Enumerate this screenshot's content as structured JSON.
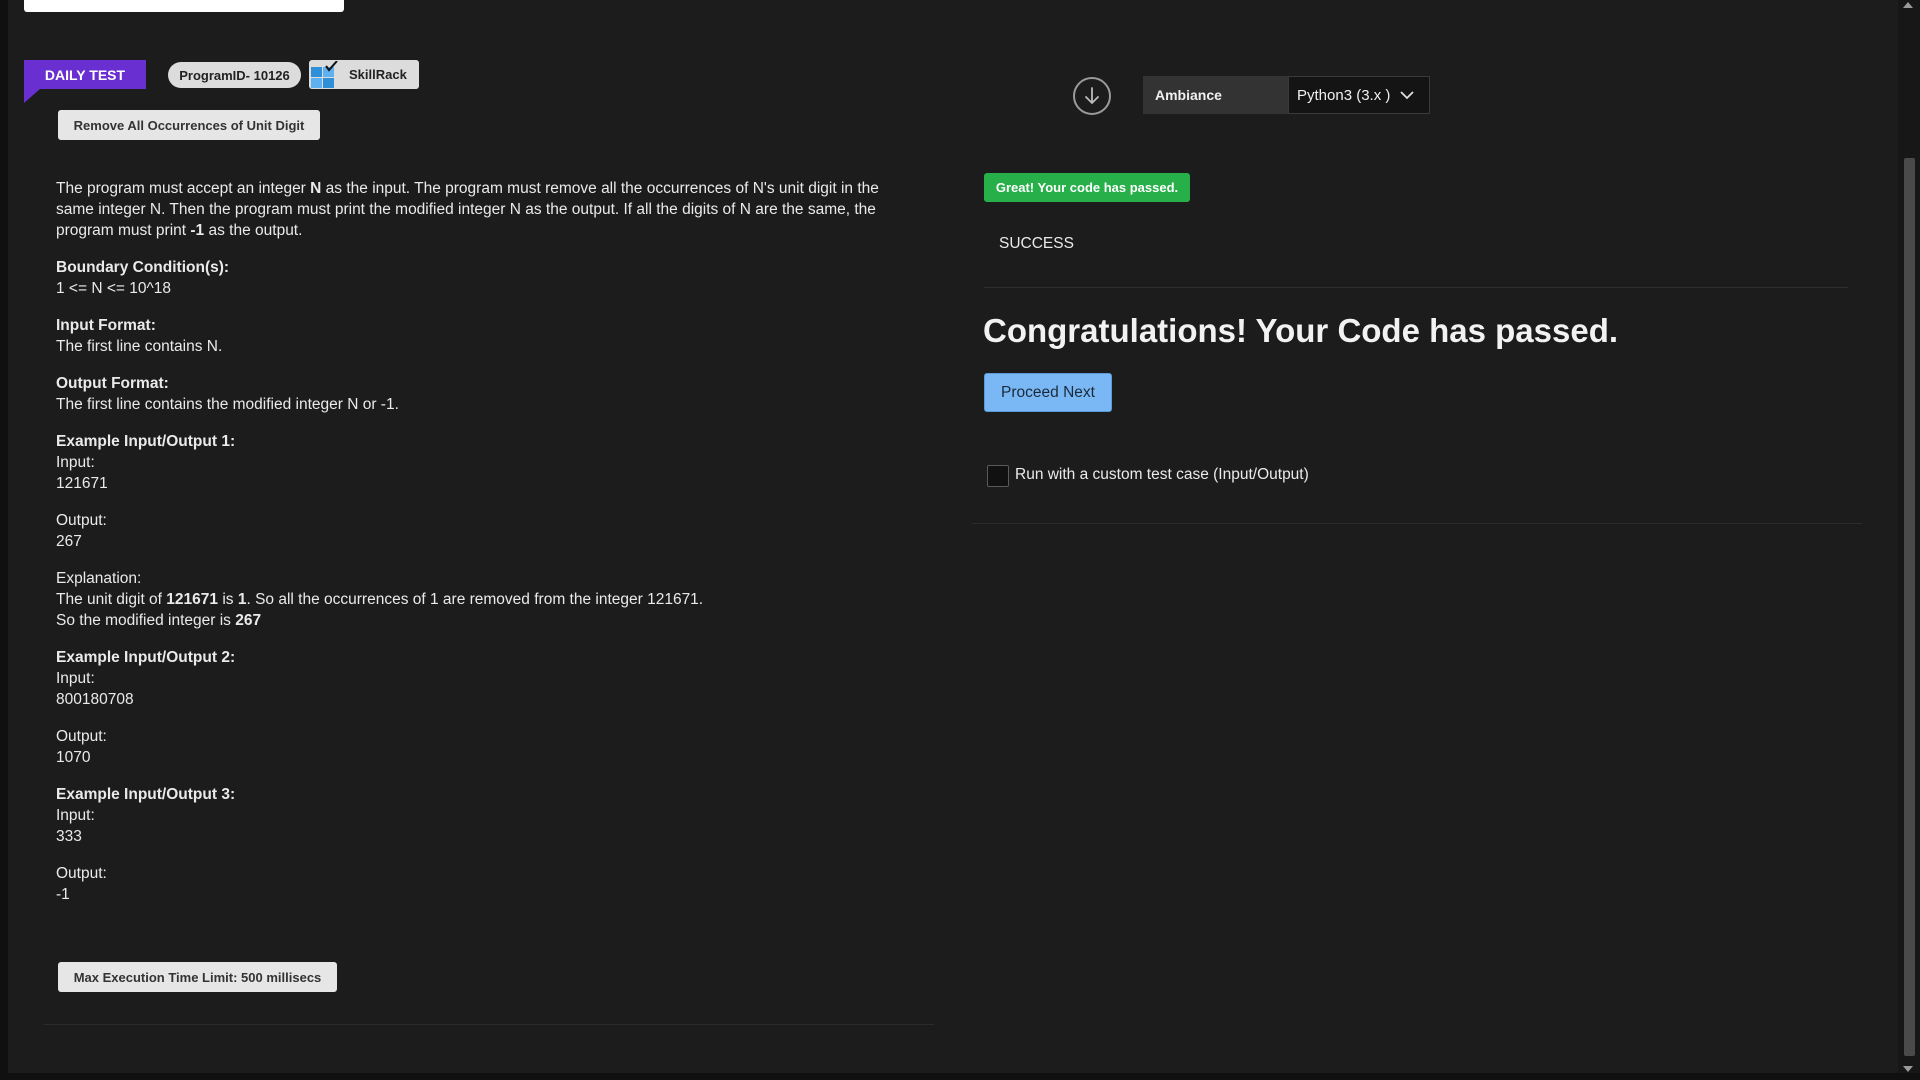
{
  "header": {
    "daily_test": "DAILY TEST",
    "program_id": "ProgramID- 10126",
    "skillrack": "SkillRack",
    "problem_title": "Remove All Occurrences of Unit Digit"
  },
  "problem": {
    "intro_1": "The program must accept an integer ",
    "intro_bold_n": "N",
    "intro_2": " as the input. The program must remove all the occurrences of N's unit digit in the same integer N. Then the program must print the modified integer N as the output. If all the digits of N are the same, the program must print ",
    "intro_bold_neg": "-1",
    "intro_3": " as the output.",
    "boundary_head": "Boundary Condition(s):",
    "boundary_value": "1 <= N <= 10^18",
    "input_format_head": "Input Format:",
    "input_format_value": "The first line contains N.",
    "output_format_head": "Output Format:",
    "output_format_value": "The first line contains the modified integer N or -1.",
    "ex1_head": "Example Input/Output 1:",
    "ex1_input_label": "Input:",
    "ex1_input": "121671",
    "ex1_output_label": "Output:",
    "ex1_output": "267",
    "ex1_expl_label": "Explanation:",
    "ex1_expl_a": "The unit digit of ",
    "ex1_expl_b": "121671",
    "ex1_expl_c": " is ",
    "ex1_expl_d": "1",
    "ex1_expl_e": ". So all the occurrences of 1 are removed from the integer 121671.",
    "ex1_expl_f": "So the modified integer is ",
    "ex1_expl_g": "267",
    "ex2_head": "Example Input/Output 2:",
    "ex2_input_label": "Input:",
    "ex2_input": "800180708",
    "ex2_output_label": "Output:",
    "ex2_output": "1070",
    "ex3_head": "Example Input/Output 3:",
    "ex3_input_label": "Input:",
    "ex3_input": "333",
    "ex3_output_label": "Output:",
    "ex3_output": "-1",
    "time_limit": "Max Execution Time Limit: 500 millisecs"
  },
  "editor": {
    "theme_label": "Ambiance",
    "language": "Python3 (3.x )",
    "download_icon": "download-arrow-icon"
  },
  "result": {
    "badge": "Great! Your code has passed.",
    "status": "SUCCESS",
    "congrats": "Congratulations! Your Code has passed.",
    "proceed": "Proceed Next",
    "custom_test_label": "Run with a custom test case (Input/Output)",
    "custom_test_checked": false
  },
  "colors": {
    "background": "#1c1c1c",
    "daily_test": "#6a2fd1",
    "passed_badge": "#27b04a",
    "proceed_button": "#7ab8f5"
  }
}
